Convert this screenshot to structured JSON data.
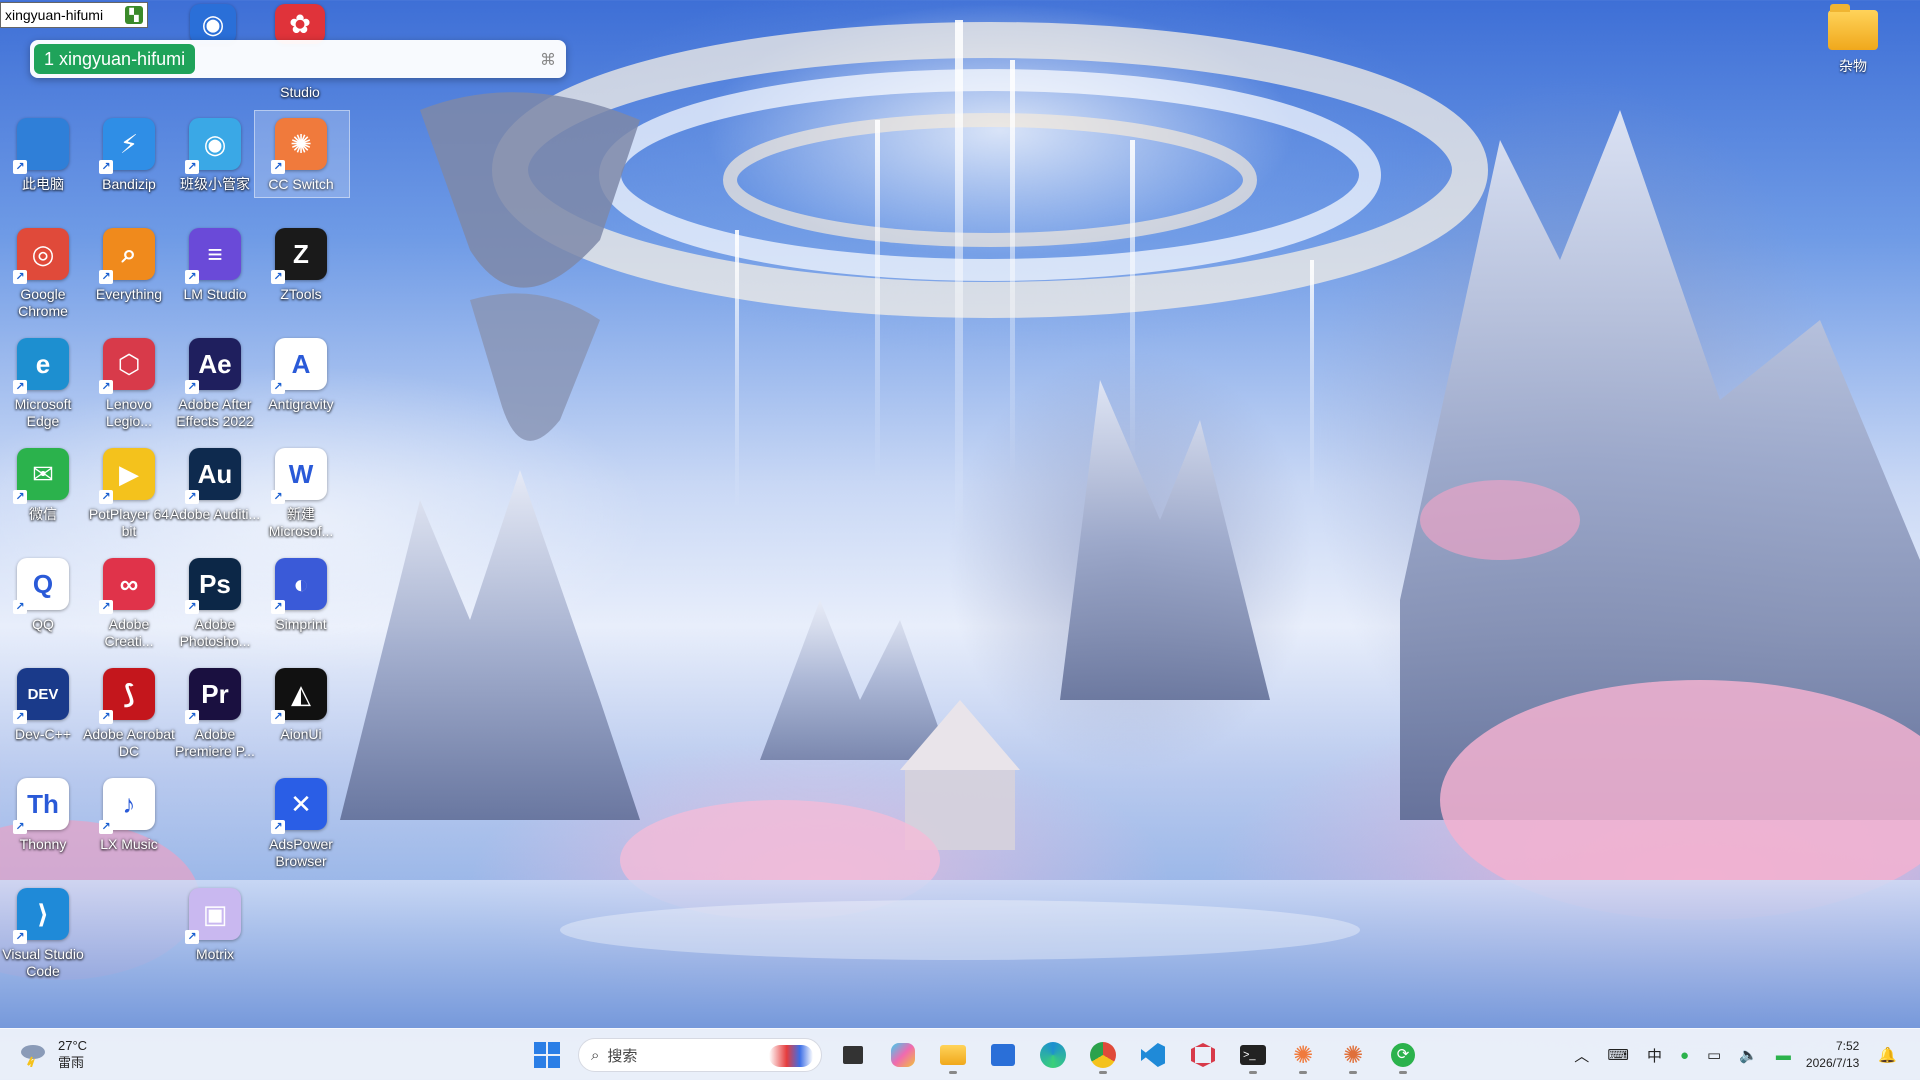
{
  "window_tag": {
    "title": "xingyuan-hifumi"
  },
  "search_popup": {
    "chip_text": "1 xingyuan-hifumi"
  },
  "desktop_icons": [
    {
      "label": "此电脑",
      "icon": "computer-icon",
      "color": "#2f7fd8",
      "text": ""
    },
    {
      "label": "Bandizip",
      "icon": "bandizip-icon",
      "color": "#2f8ee6",
      "text": "⚡"
    },
    {
      "label": "班级小管家",
      "icon": "class-manager-icon",
      "color": "#3aa8e6",
      "text": "◉"
    },
    {
      "label": "CC Switch",
      "icon": "cc-switch-icon",
      "color": "#f07a3c",
      "text": "✺"
    },
    {
      "label": "Google Chrome",
      "icon": "chrome-icon",
      "color": "#e04a3a",
      "text": "◎"
    },
    {
      "label": "Everything",
      "icon": "everything-icon",
      "color": "#f08a1c",
      "text": "⌕"
    },
    {
      "label": "LM Studio",
      "icon": "lm-studio-icon",
      "color": "#6a4ad8",
      "text": "≡"
    },
    {
      "label": "ZTools",
      "icon": "ztools-icon",
      "color": "#1a1a1a",
      "text": "Z"
    },
    {
      "label": "Microsoft Edge",
      "icon": "edge-icon",
      "color": "#1d8fd0",
      "text": "e"
    },
    {
      "label": "Lenovo Legio...",
      "icon": "lenovo-legion-icon",
      "color": "#d83a4a",
      "text": "⬡"
    },
    {
      "label": "Adobe After Effects 2022",
      "icon": "after-effects-icon",
      "color": "#1f1f5e",
      "text": "Ae"
    },
    {
      "label": "Antigravity",
      "icon": "antigravity-icon",
      "color": "#ffffff",
      "text": "A"
    },
    {
      "label": "微信",
      "icon": "wechat-icon",
      "color": "#2bb24c",
      "text": "✉"
    },
    {
      "label": "PotPlayer 64 bit",
      "icon": "potplayer-icon",
      "color": "#f4c21c",
      "text": "▶"
    },
    {
      "label": "Adobe Auditi...",
      "icon": "audition-icon",
      "color": "#0e2a4e",
      "text": "Au"
    },
    {
      "label": "新建 Microsof...",
      "icon": "word-doc-icon",
      "color": "#ffffff",
      "text": "W"
    },
    {
      "label": "QQ",
      "icon": "qq-icon",
      "color": "#ffffff",
      "text": "Q"
    },
    {
      "label": "Adobe Creati...",
      "icon": "creative-cloud-icon",
      "color": "#e0334a",
      "text": "∞"
    },
    {
      "label": "Adobe Photosho...",
      "icon": "photoshop-icon",
      "color": "#0c2747",
      "text": "Ps"
    },
    {
      "label": "Simprint",
      "icon": "simprint-icon",
      "color": "#3a5ad8",
      "text": "◐"
    },
    {
      "label": "Dev-C++",
      "icon": "dev-cpp-icon",
      "color": "#1a3a8a",
      "text": "DEV"
    },
    {
      "label": "Adobe Acrobat DC",
      "icon": "acrobat-icon",
      "color": "#c4161c",
      "text": "⟆"
    },
    {
      "label": "Adobe Premiere P...",
      "icon": "premiere-icon",
      "color": "#1a1040",
      "text": "Pr"
    },
    {
      "label": "AionUi",
      "icon": "aionui-icon",
      "color": "#111111",
      "text": "◭"
    },
    {
      "label": "Thonny",
      "icon": "thonny-icon",
      "color": "#ffffff",
      "text": "Th"
    },
    {
      "label": "LX Music",
      "icon": "lx-music-icon",
      "color": "#ffffff",
      "text": "♪"
    },
    {
      "label": "",
      "icon": "empty-slot",
      "color": "",
      "text": ""
    },
    {
      "label": "AdsPower Browser",
      "icon": "adspower-icon",
      "color": "#2a5ee6",
      "text": "✕"
    },
    {
      "label": "Visual Studio Code",
      "icon": "vscode-icon",
      "color": "#1f8ad8",
      "text": "⟩"
    },
    {
      "label": "",
      "icon": "empty-slot",
      "color": "",
      "text": ""
    },
    {
      "label": "Motrix",
      "icon": "motrix-icon",
      "color": "#c9b8f0",
      "text": "▣"
    }
  ],
  "top_row_icons": [
    {
      "label": "Studio",
      "icon": "studio-icon",
      "color": "#e0333a"
    }
  ],
  "folder": {
    "label": "杂物"
  },
  "taskbar": {
    "weather": {
      "temp": "27°C",
      "condition": "雷雨"
    },
    "search_placeholder": "搜索",
    "apps": [
      "windows-start-icon",
      "task-view-icon",
      "copilot-icon",
      "file-explorer-icon",
      "microsoft-store-icon",
      "edge-icon",
      "chrome-icon",
      "vscode-icon",
      "lenovo-legion-icon",
      "terminal-icon",
      "cc-switch-icon",
      "claude-icon",
      "sync-icon"
    ],
    "ime": "中",
    "time": "7:52",
    "date": "2026/7/13"
  },
  "colors": {
    "accent": "#1fa35a",
    "taskbar_bg": "#eef2fa"
  }
}
